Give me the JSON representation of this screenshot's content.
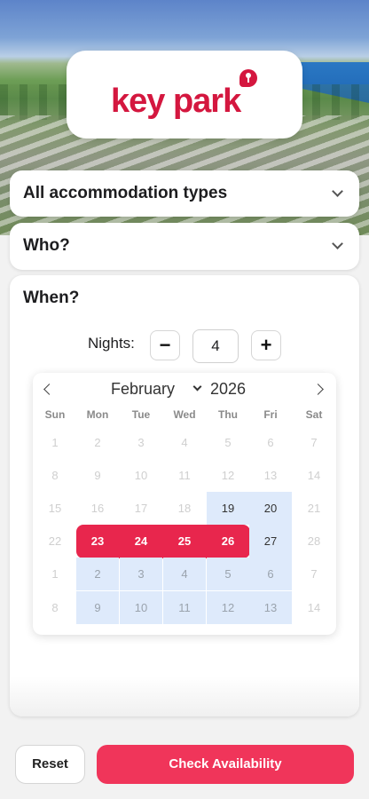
{
  "brand": {
    "name": "key park",
    "color": "#d4173f"
  },
  "filters": {
    "accommodation": {
      "label": "All accommodation types"
    },
    "who": {
      "label": "Who?"
    },
    "when": {
      "label": "When?"
    }
  },
  "nights": {
    "label": "Nights:",
    "value": "4",
    "decrement": "−",
    "increment": "+"
  },
  "calendar": {
    "month": "February",
    "year": "2026",
    "weekdays": [
      "Sun",
      "Mon",
      "Tue",
      "Wed",
      "Thu",
      "Fri",
      "Sat"
    ],
    "weeks": [
      [
        "1",
        "2",
        "3",
        "4",
        "5",
        "6",
        "7"
      ],
      [
        "8",
        "9",
        "10",
        "11",
        "12",
        "13",
        "14"
      ],
      [
        "15",
        "16",
        "17",
        "18",
        "19",
        "20",
        "21"
      ],
      [
        "22",
        "23",
        "24",
        "25",
        "26",
        "27",
        "28"
      ],
      [
        "1",
        "2",
        "3",
        "4",
        "5",
        "6",
        "7"
      ],
      [
        "8",
        "9",
        "10",
        "11",
        "12",
        "13",
        "14"
      ]
    ],
    "selected": [
      "23",
      "24",
      "25",
      "26"
    ],
    "highlight_color": "#deeafb",
    "selected_color": "#e8264d"
  },
  "actions": {
    "reset": "Reset",
    "check": "Check Availability",
    "check_color": "#f0355a"
  }
}
